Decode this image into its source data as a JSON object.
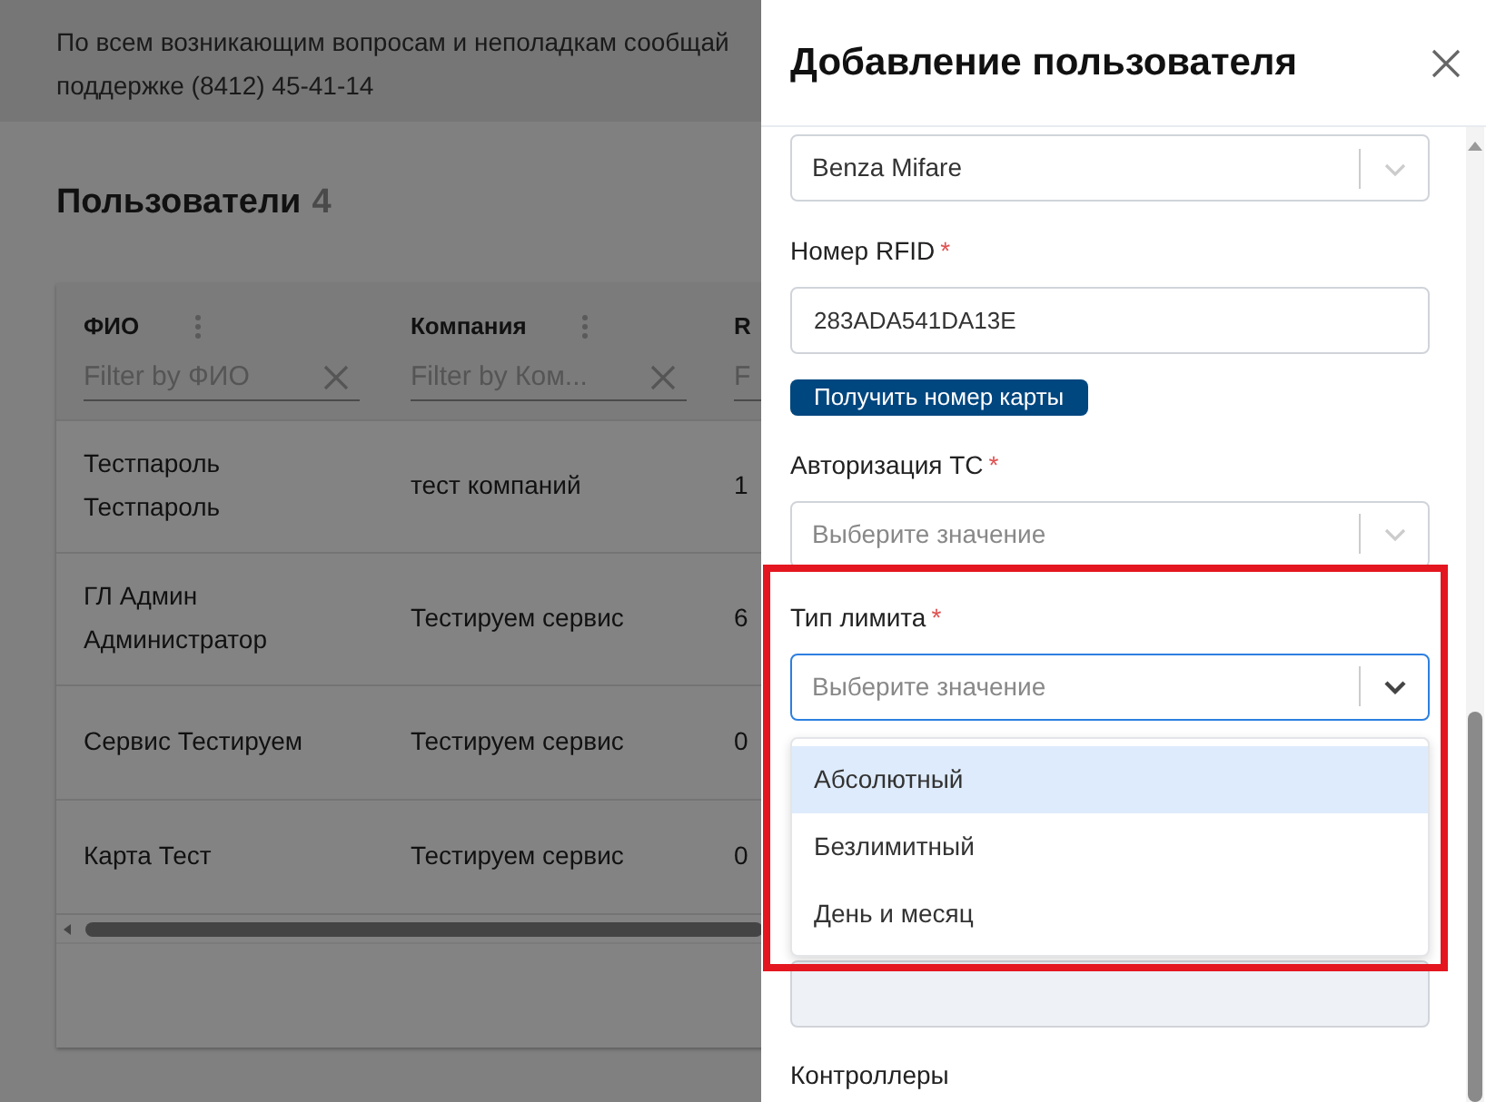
{
  "notice": {
    "lines": [
      "По всем возникающим вопросам и неполадкам сообщай",
      "поддержке (8412) 45-41-14"
    ]
  },
  "page": {
    "title": "Пользователи",
    "count": "4"
  },
  "table": {
    "columns": [
      {
        "label": "ФИО",
        "filter_placeholder": "Filter by ФИО"
      },
      {
        "label": "Компания",
        "filter_placeholder": "Filter by Ком..."
      },
      {
        "label": "R",
        "filter_placeholder": "F"
      }
    ],
    "rows": [
      {
        "cells": [
          "Тестпароль Тестпароль",
          "тест компаний",
          "1"
        ]
      },
      {
        "cells": [
          "ГЛ Админ Администратор",
          "Тестируем сервис",
          "6"
        ]
      },
      {
        "cells": [
          "Сервис Тестируем",
          "Тестируем сервис",
          "0"
        ]
      },
      {
        "cells": [
          "Карта Тест",
          "Тестируем сервис",
          "0"
        ]
      }
    ]
  },
  "drawer": {
    "title": "Добавление пользователя",
    "fields": [
      {
        "kind": "select",
        "value": "Benza Mifare"
      },
      {
        "kind": "input",
        "label": "Номер RFID",
        "mark": "*",
        "value": "283ADA541DA13E"
      },
      {
        "kind": "button",
        "label": "Получить номер карты"
      },
      {
        "kind": "select",
        "label": "Авторизация ТС",
        "mark": "*",
        "placeholder": "Выберите значение",
        "focused": false
      },
      {
        "kind": "select",
        "label": "Тип лимита",
        "mark": "*",
        "placeholder": "Выберите значение",
        "focused": true,
        "highlighted": true,
        "options": [
          {
            "label": "Абсолютный",
            "selected": true
          },
          {
            "label": "Безлимитный",
            "selected": false
          },
          {
            "label": "День и месяц",
            "selected": false
          }
        ]
      },
      {
        "kind": "input",
        "disabled": true
      },
      {
        "kind": "label",
        "label": "Контроллеры"
      }
    ]
  }
}
